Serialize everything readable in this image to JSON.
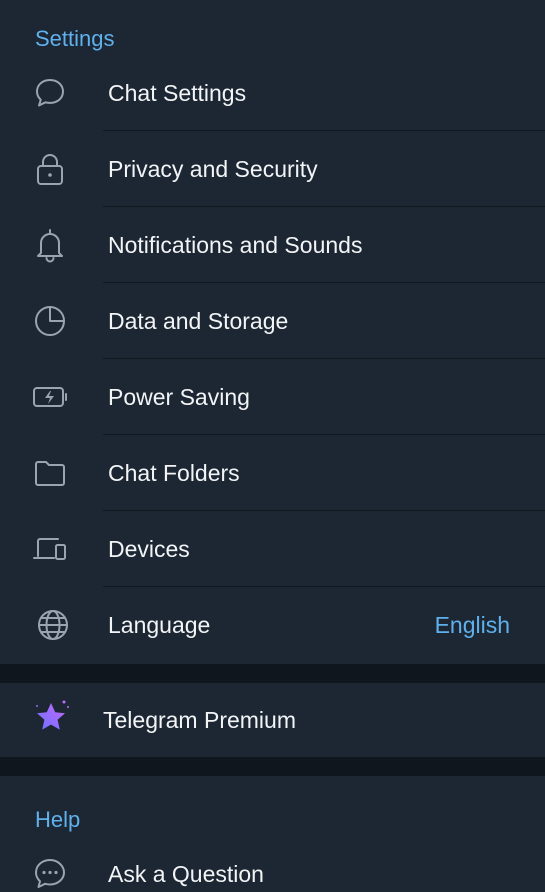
{
  "settings": {
    "header": "Settings",
    "items": [
      {
        "label": "Chat Settings",
        "icon": "chat-bubble-icon"
      },
      {
        "label": "Privacy and Security",
        "icon": "lock-icon"
      },
      {
        "label": "Notifications and Sounds",
        "icon": "bell-icon"
      },
      {
        "label": "Data and Storage",
        "icon": "pie-chart-icon"
      },
      {
        "label": "Power Saving",
        "icon": "battery-bolt-icon"
      },
      {
        "label": "Chat Folders",
        "icon": "folder-icon"
      },
      {
        "label": "Devices",
        "icon": "devices-icon"
      },
      {
        "label": "Language",
        "icon": "globe-icon",
        "value": "English"
      }
    ]
  },
  "premium": {
    "label": "Telegram Premium",
    "icon": "premium-star-icon"
  },
  "help": {
    "header": "Help",
    "items": [
      {
        "label": "Ask a Question",
        "icon": "chat-dots-icon"
      }
    ]
  },
  "colors": {
    "background": "#0f161e",
    "section": "#1c2733",
    "accent": "#5fb0ec",
    "text": "#f2f4f6",
    "icon": "#9aa4ae",
    "premium_star": [
      "#6b73ff",
      "#c467ff"
    ]
  }
}
